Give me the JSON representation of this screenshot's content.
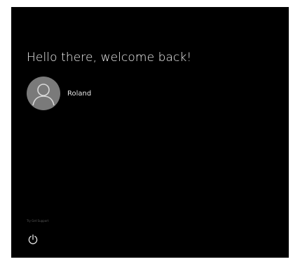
{
  "greeting": "Hello there, welcome back!",
  "user": {
    "name": "Roland",
    "avatar_icon": "user-silhouette-icon"
  },
  "footer": {
    "fine_print": "Try Get Support",
    "power_icon": "power-icon"
  },
  "colors": {
    "background": "#000000",
    "text": "#ffffff",
    "avatar": "#7a7a7a"
  }
}
